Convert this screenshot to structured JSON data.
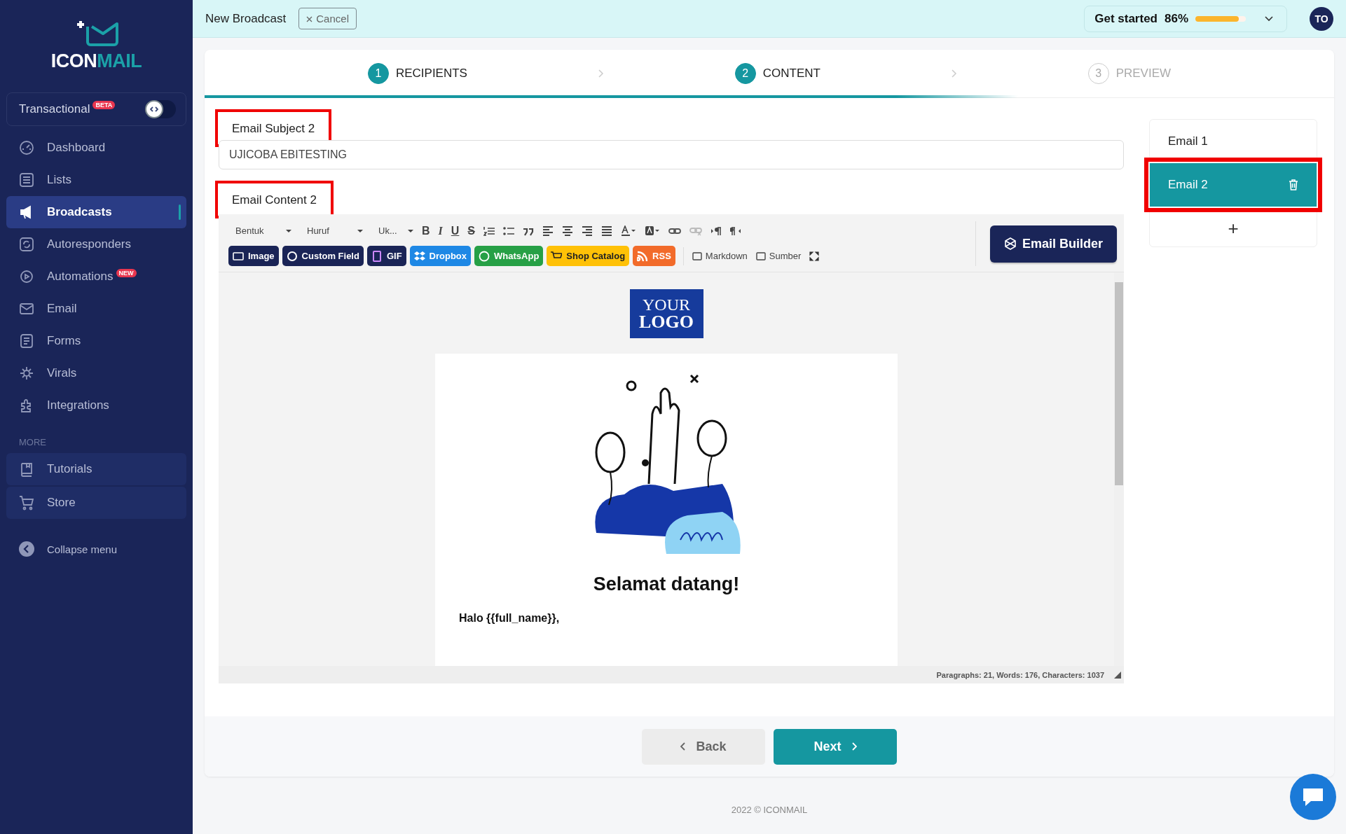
{
  "sidebar": {
    "logo": {
      "part1": "ICON",
      "part2": "MAIL"
    },
    "transactional": {
      "label": "Transactional",
      "badge": "BETA",
      "on": false
    },
    "nav": [
      {
        "label": "Dashboard",
        "selected": false
      },
      {
        "label": "Lists",
        "selected": false
      },
      {
        "label": "Broadcasts",
        "selected": true
      },
      {
        "label": "Autoresponders",
        "selected": false
      },
      {
        "label": "Automations",
        "selected": false,
        "badge": "NEW"
      },
      {
        "label": "Email",
        "selected": false
      },
      {
        "label": "Forms",
        "selected": false
      },
      {
        "label": "Virals",
        "selected": false
      },
      {
        "label": "Integrations",
        "selected": false
      }
    ],
    "section_label": "MORE",
    "more": [
      {
        "label": "Tutorials"
      },
      {
        "label": "Store"
      }
    ],
    "collapse": "Collapse menu"
  },
  "topbar": {
    "title": "New Broadcast",
    "cancel": "Cancel",
    "progress": {
      "label": "Get started",
      "percent": "86%",
      "level": 0.86
    },
    "avatar": "TO"
  },
  "steps": {
    "level": 0.72,
    "items": [
      {
        "number": "1",
        "label": "RECIPIENTS",
        "active": true
      },
      {
        "number": "2",
        "label": "CONTENT",
        "active": true
      },
      {
        "number": "3",
        "label": "PREVIEW",
        "active": false
      }
    ]
  },
  "subject": {
    "label": "Email Subject 2",
    "highlighted": true,
    "value": "UJICOBA EBITESTING"
  },
  "content": {
    "label": "Email Content 2",
    "highlighted": true
  },
  "toolbar": {
    "dropdowns": [
      "Bentuk",
      "Huruf",
      "Uk..."
    ],
    "format": [
      "B",
      "I",
      "U",
      "S"
    ],
    "insert_buttons": [
      {
        "label": "Image",
        "color": "#1a2456"
      },
      {
        "label": "Custom Field",
        "color": "#1a2456"
      },
      {
        "label": "GIF",
        "color": "#1a2456"
      },
      {
        "label": "Dropbox",
        "color": "#1e88e5"
      },
      {
        "label": "WhatsApp",
        "color": "#27a046"
      },
      {
        "label": "Shop Catalog",
        "color": "#ffc107"
      },
      {
        "label": "RSS",
        "color": "#f26b2a"
      }
    ],
    "plain_buttons": [
      "Markdown",
      "Sumber"
    ],
    "email_builder": "Email Builder"
  },
  "preview": {
    "logo_line1": "YOUR",
    "logo_line2": "LOGO",
    "heading": "Selamat datang!",
    "greeting": "Halo {{full_name}},"
  },
  "status": "Paragraphs: 21, Words: 176, Characters: 1037",
  "emails": {
    "items": [
      {
        "label": "Email 1",
        "selected": false,
        "highlighted": false
      },
      {
        "label": "Email 2",
        "selected": true,
        "highlighted": true
      }
    ],
    "add": "+"
  },
  "buttons": {
    "back": "Back",
    "next": "Next"
  },
  "footer": "2022 © ICONMAIL"
}
